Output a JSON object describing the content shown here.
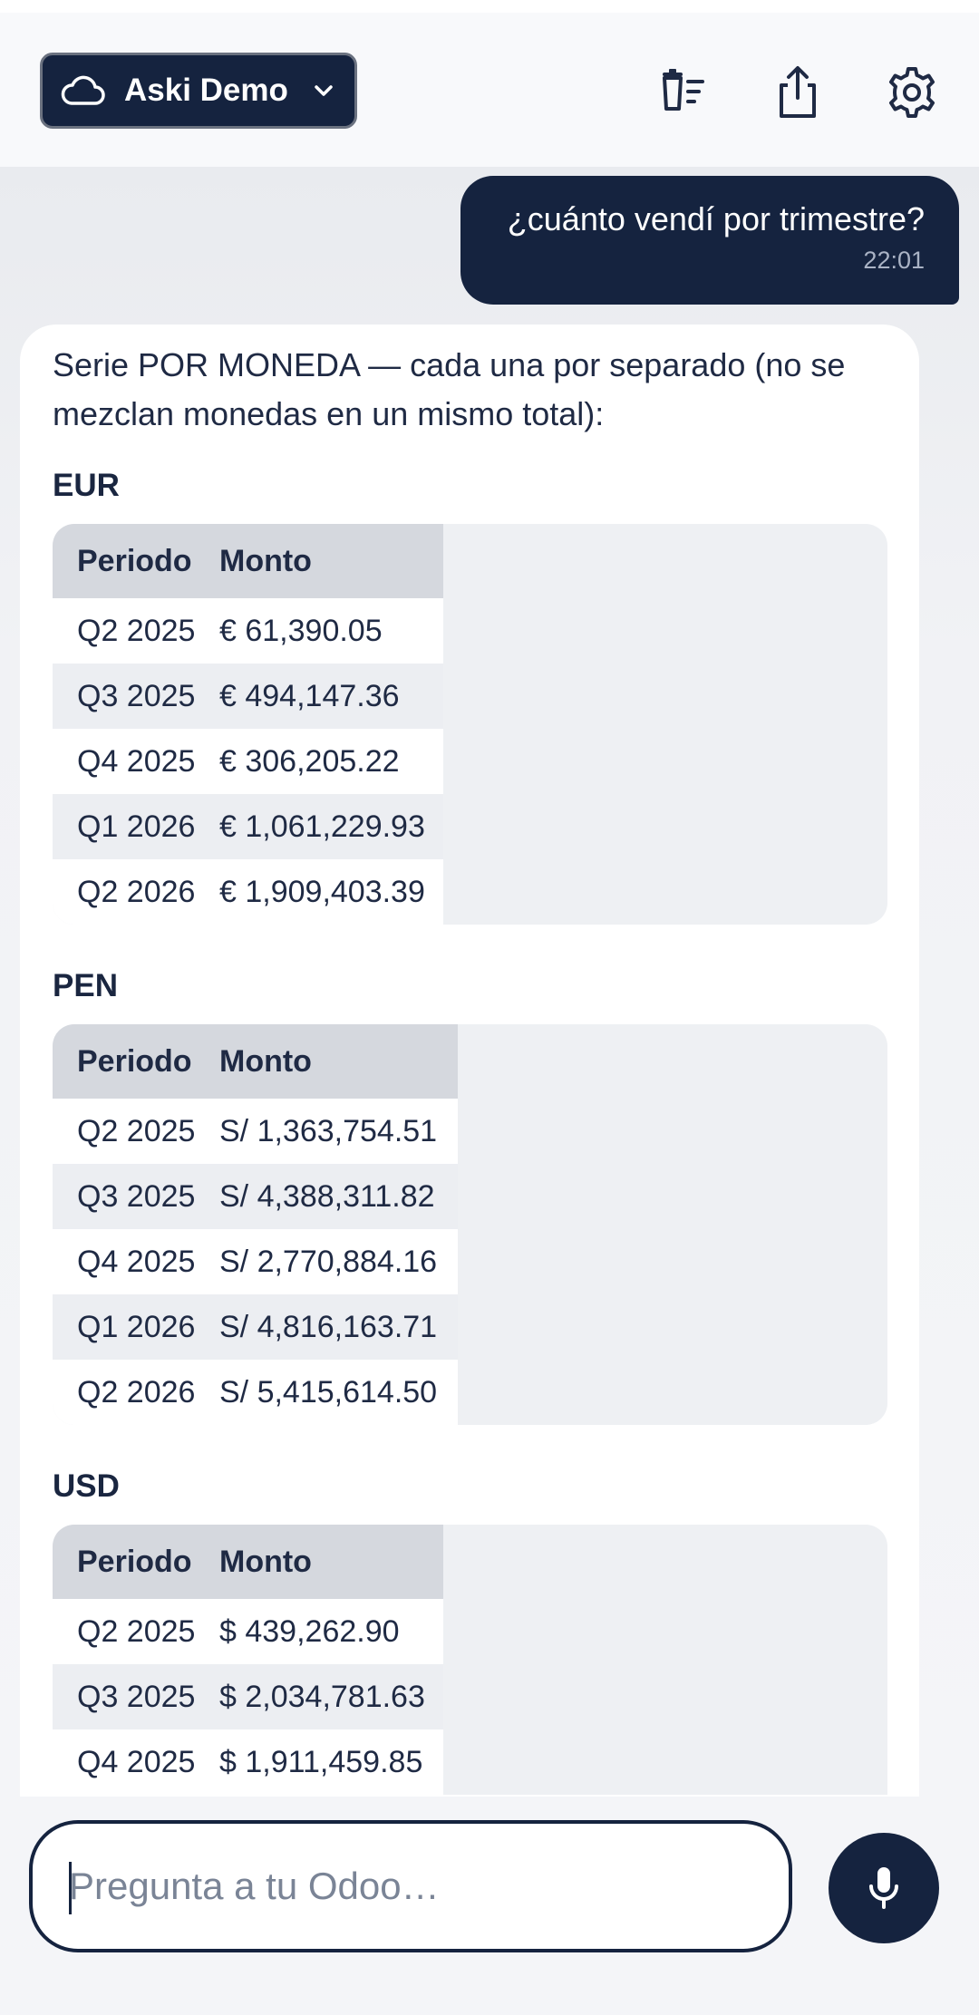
{
  "header": {
    "workspace_label": "Aski Demo"
  },
  "user_message": {
    "text": "¿cuánto vendí por trimestre?",
    "time": "22:01"
  },
  "bot_message": {
    "intro": "Serie POR MONEDA — cada una por separado (no se mezclan monedas en un mismo total):",
    "sections": [
      {
        "currency": "EUR",
        "columns": [
          "Periodo",
          "Monto"
        ],
        "rows": [
          [
            "Q2 2025",
            "€ 61,390.05"
          ],
          [
            "Q3 2025",
            "€ 494,147.36"
          ],
          [
            "Q4 2025",
            "€ 306,205.22"
          ],
          [
            "Q1 2026",
            "€ 1,061,229.93"
          ],
          [
            "Q2 2026",
            "€ 1,909,403.39"
          ]
        ]
      },
      {
        "currency": "PEN",
        "columns": [
          "Periodo",
          "Monto"
        ],
        "rows": [
          [
            "Q2 2025",
            "S/ 1,363,754.51"
          ],
          [
            "Q3 2025",
            "S/ 4,388,311.82"
          ],
          [
            "Q4 2025",
            "S/ 2,770,884.16"
          ],
          [
            "Q1 2026",
            "S/ 4,816,163.71"
          ],
          [
            "Q2 2026",
            "S/ 5,415,614.50"
          ]
        ]
      },
      {
        "currency": "USD",
        "columns": [
          "Periodo",
          "Monto"
        ],
        "rows": [
          [
            "Q2 2025",
            "$ 439,262.90"
          ],
          [
            "Q3 2025",
            "$ 2,034,781.63"
          ],
          [
            "Q4 2025",
            "$ 1,911,459.85"
          ]
        ]
      }
    ]
  },
  "composer": {
    "placeholder": "Pregunta a tu Odoo…"
  },
  "icons": {
    "workspace": "cloud-icon",
    "dropdown": "chevron-down-icon",
    "clear": "clear-history-icon",
    "share": "share-icon",
    "settings": "gear-icon",
    "mic": "microphone-icon"
  },
  "colors": {
    "brand_navy": "#15233f",
    "table_header": "#d5d8de",
    "table_stripe": "#eceef2"
  }
}
